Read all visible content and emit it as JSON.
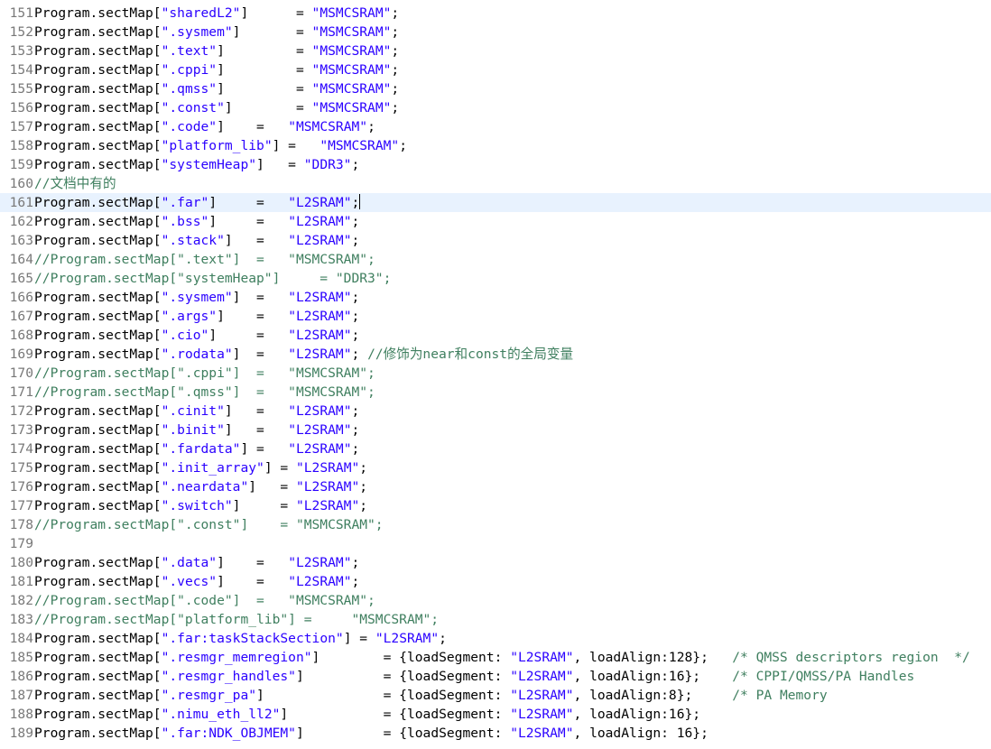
{
  "editor": {
    "current_line": 161,
    "lines": [
      {
        "n": "151",
        "t": [
          [
            "Program.sectMap[",
            ""
          ],
          [
            "\"sharedL2\"",
            "s"
          ],
          [
            "]      = ",
            ""
          ],
          [
            "\"MSMCSRAM\"",
            "s"
          ],
          [
            ";",
            ""
          ]
        ]
      },
      {
        "n": "152",
        "t": [
          [
            "Program.sectMap[",
            ""
          ],
          [
            "\".sysmem\"",
            "s"
          ],
          [
            "]       = ",
            ""
          ],
          [
            "\"MSMCSRAM\"",
            "s"
          ],
          [
            ";",
            ""
          ]
        ]
      },
      {
        "n": "153",
        "t": [
          [
            "Program.sectMap[",
            ""
          ],
          [
            "\".text\"",
            "s"
          ],
          [
            "]         = ",
            ""
          ],
          [
            "\"MSMCSRAM\"",
            "s"
          ],
          [
            ";",
            ""
          ]
        ]
      },
      {
        "n": "154",
        "t": [
          [
            "Program.sectMap[",
            ""
          ],
          [
            "\".cppi\"",
            "s"
          ],
          [
            "]         = ",
            ""
          ],
          [
            "\"MSMCSRAM\"",
            "s"
          ],
          [
            ";",
            ""
          ]
        ]
      },
      {
        "n": "155",
        "t": [
          [
            "Program.sectMap[",
            ""
          ],
          [
            "\".qmss\"",
            "s"
          ],
          [
            "]         = ",
            ""
          ],
          [
            "\"MSMCSRAM\"",
            "s"
          ],
          [
            ";",
            ""
          ]
        ]
      },
      {
        "n": "156",
        "t": [
          [
            "Program.sectMap[",
            ""
          ],
          [
            "\".const\"",
            "s"
          ],
          [
            "]        = ",
            ""
          ],
          [
            "\"MSMCSRAM\"",
            "s"
          ],
          [
            ";",
            ""
          ]
        ]
      },
      {
        "n": "157",
        "t": [
          [
            "Program.sectMap[",
            ""
          ],
          [
            "\".code\"",
            "s"
          ],
          [
            "]    =   ",
            ""
          ],
          [
            "\"MSMCSRAM\"",
            "s"
          ],
          [
            ";",
            ""
          ]
        ]
      },
      {
        "n": "158",
        "t": [
          [
            "Program.sectMap[",
            ""
          ],
          [
            "\"platform_lib\"",
            "s"
          ],
          [
            "] =   ",
            ""
          ],
          [
            "\"MSMCSRAM\"",
            "s"
          ],
          [
            ";",
            ""
          ]
        ]
      },
      {
        "n": "159",
        "t": [
          [
            "Program.sectMap[",
            ""
          ],
          [
            "\"systemHeap\"",
            "s"
          ],
          [
            "]   = ",
            ""
          ],
          [
            "\"DDR3\"",
            "s"
          ],
          [
            ";",
            ""
          ]
        ]
      },
      {
        "n": "160",
        "t": [
          [
            "//文档中有的",
            "c"
          ]
        ]
      },
      {
        "n": "161",
        "t": [
          [
            "Program.sectMap[",
            ""
          ],
          [
            "\".far\"",
            "s"
          ],
          [
            "]     =   ",
            ""
          ],
          [
            "\"L2SRAM\"",
            "s"
          ],
          [
            ";",
            ""
          ]
        ]
      },
      {
        "n": "162",
        "t": [
          [
            "Program.sectMap[",
            ""
          ],
          [
            "\".bss\"",
            "s"
          ],
          [
            "]     =   ",
            ""
          ],
          [
            "\"L2SRAM\"",
            "s"
          ],
          [
            ";",
            ""
          ]
        ]
      },
      {
        "n": "163",
        "t": [
          [
            "Program.sectMap[",
            ""
          ],
          [
            "\".stack\"",
            "s"
          ],
          [
            "]   =   ",
            ""
          ],
          [
            "\"L2SRAM\"",
            "s"
          ],
          [
            ";",
            ""
          ]
        ]
      },
      {
        "n": "164",
        "t": [
          [
            "//Program.sectMap[\".text\"]  =   \"MSMCSRAM\";",
            "c"
          ]
        ]
      },
      {
        "n": "165",
        "t": [
          [
            "//Program.sectMap[\"systemHeap\"]     = \"DDR3\";",
            "c"
          ]
        ]
      },
      {
        "n": "166",
        "t": [
          [
            "Program.sectMap[",
            ""
          ],
          [
            "\".sysmem\"",
            "s"
          ],
          [
            "]  =   ",
            ""
          ],
          [
            "\"L2SRAM\"",
            "s"
          ],
          [
            ";",
            ""
          ]
        ]
      },
      {
        "n": "167",
        "t": [
          [
            "Program.sectMap[",
            ""
          ],
          [
            "\".args\"",
            "s"
          ],
          [
            "]    =   ",
            ""
          ],
          [
            "\"L2SRAM\"",
            "s"
          ],
          [
            ";",
            ""
          ]
        ]
      },
      {
        "n": "168",
        "t": [
          [
            "Program.sectMap[",
            ""
          ],
          [
            "\".cio\"",
            "s"
          ],
          [
            "]     =   ",
            ""
          ],
          [
            "\"L2SRAM\"",
            "s"
          ],
          [
            ";",
            ""
          ]
        ]
      },
      {
        "n": "169",
        "t": [
          [
            "Program.sectMap[",
            ""
          ],
          [
            "\".rodata\"",
            "s"
          ],
          [
            "]  =   ",
            ""
          ],
          [
            "\"L2SRAM\"",
            "s"
          ],
          [
            "; ",
            ""
          ],
          [
            "//修饰为near和const的全局变量",
            "c"
          ]
        ]
      },
      {
        "n": "170",
        "t": [
          [
            "//Program.sectMap[\".cppi\"]  =   \"MSMCSRAM\";",
            "c"
          ]
        ]
      },
      {
        "n": "171",
        "t": [
          [
            "//Program.sectMap[\".qmss\"]  =   \"MSMCSRAM\";",
            "c"
          ]
        ]
      },
      {
        "n": "172",
        "t": [
          [
            "Program.sectMap[",
            ""
          ],
          [
            "\".cinit\"",
            "s"
          ],
          [
            "]   =   ",
            ""
          ],
          [
            "\"L2SRAM\"",
            "s"
          ],
          [
            ";",
            ""
          ]
        ]
      },
      {
        "n": "173",
        "t": [
          [
            "Program.sectMap[",
            ""
          ],
          [
            "\".binit\"",
            "s"
          ],
          [
            "]   =   ",
            ""
          ],
          [
            "\"L2SRAM\"",
            "s"
          ],
          [
            ";",
            ""
          ]
        ]
      },
      {
        "n": "174",
        "t": [
          [
            "Program.sectMap[",
            ""
          ],
          [
            "\".fardata\"",
            "s"
          ],
          [
            "] =   ",
            ""
          ],
          [
            "\"L2SRAM\"",
            "s"
          ],
          [
            ";",
            ""
          ]
        ]
      },
      {
        "n": "175",
        "t": [
          [
            "Program.sectMap[",
            ""
          ],
          [
            "\".init_array\"",
            "s"
          ],
          [
            "] = ",
            ""
          ],
          [
            "\"L2SRAM\"",
            "s"
          ],
          [
            ";",
            ""
          ]
        ]
      },
      {
        "n": "176",
        "t": [
          [
            "Program.sectMap[",
            ""
          ],
          [
            "\".neardata\"",
            "s"
          ],
          [
            "]   = ",
            ""
          ],
          [
            "\"L2SRAM\"",
            "s"
          ],
          [
            ";",
            ""
          ]
        ]
      },
      {
        "n": "177",
        "t": [
          [
            "Program.sectMap[",
            ""
          ],
          [
            "\".switch\"",
            "s"
          ],
          [
            "]     = ",
            ""
          ],
          [
            "\"L2SRAM\"",
            "s"
          ],
          [
            ";",
            ""
          ]
        ]
      },
      {
        "n": "178",
        "t": [
          [
            "//Program.sectMap[\".const\"]    = \"MSMCSRAM\";",
            "c"
          ]
        ]
      },
      {
        "n": "179",
        "t": []
      },
      {
        "n": "180",
        "t": [
          [
            "Program.sectMap[",
            ""
          ],
          [
            "\".data\"",
            "s"
          ],
          [
            "]    =   ",
            ""
          ],
          [
            "\"L2SRAM\"",
            "s"
          ],
          [
            ";",
            ""
          ]
        ]
      },
      {
        "n": "181",
        "t": [
          [
            "Program.sectMap[",
            ""
          ],
          [
            "\".vecs\"",
            "s"
          ],
          [
            "]    =   ",
            ""
          ],
          [
            "\"L2SRAM\"",
            "s"
          ],
          [
            ";",
            ""
          ]
        ]
      },
      {
        "n": "182",
        "t": [
          [
            "//Program.sectMap[\".code\"]  =   \"MSMCSRAM\";",
            "c"
          ]
        ]
      },
      {
        "n": "183",
        "t": [
          [
            "//Program.sectMap[\"platform_lib\"] =     \"MSMCSRAM\";",
            "c"
          ]
        ]
      },
      {
        "n": "184",
        "t": [
          [
            "Program.sectMap[",
            ""
          ],
          [
            "\".far:taskStackSection\"",
            "s"
          ],
          [
            "] = ",
            ""
          ],
          [
            "\"L2SRAM\"",
            "s"
          ],
          [
            ";",
            ""
          ]
        ]
      },
      {
        "n": "185",
        "t": [
          [
            "Program.sectMap[",
            ""
          ],
          [
            "\".resmgr_memregion\"",
            "s"
          ],
          [
            "]        = {loadSegment: ",
            ""
          ],
          [
            "\"L2SRAM\"",
            "s"
          ],
          [
            ", loadAlign:128};   ",
            ""
          ],
          [
            "/* QMSS descriptors region  */",
            "c"
          ]
        ]
      },
      {
        "n": "186",
        "t": [
          [
            "Program.sectMap[",
            ""
          ],
          [
            "\".resmgr_handles\"",
            "s"
          ],
          [
            "]          = {loadSegment: ",
            ""
          ],
          [
            "\"L2SRAM\"",
            "s"
          ],
          [
            ", loadAlign:16};    ",
            ""
          ],
          [
            "/* CPPI/QMSS/PA Handles",
            "c"
          ]
        ]
      },
      {
        "n": "187",
        "t": [
          [
            "Program.sectMap[",
            ""
          ],
          [
            "\".resmgr_pa\"",
            "s"
          ],
          [
            "]               = {loadSegment: ",
            ""
          ],
          [
            "\"L2SRAM\"",
            "s"
          ],
          [
            ", loadAlign:8};     ",
            ""
          ],
          [
            "/* PA Memory",
            "c"
          ]
        ]
      },
      {
        "n": "188",
        "t": [
          [
            "Program.sectMap[",
            ""
          ],
          [
            "\".nimu_eth_ll2\"",
            "s"
          ],
          [
            "]            = {loadSegment: ",
            ""
          ],
          [
            "\"L2SRAM\"",
            "s"
          ],
          [
            ", loadAlign:16};",
            ""
          ]
        ]
      },
      {
        "n": "189",
        "t": [
          [
            "Program.sectMap[",
            ""
          ],
          [
            "\".far:NDK_OBJMEM\"",
            "s"
          ],
          [
            "]          = {loadSegment: ",
            ""
          ],
          [
            "\"L2SRAM\"",
            "s"
          ],
          [
            ", loadAlign: 16};",
            ""
          ]
        ]
      }
    ]
  }
}
